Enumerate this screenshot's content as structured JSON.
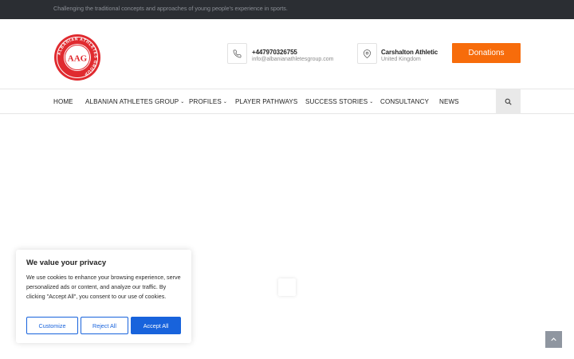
{
  "topbar": {
    "tagline": "Challenging the traditional concepts and approaches of young people's experience in sports."
  },
  "logo": {
    "alt_text": "Albanian Athletes Group",
    "monogram": "AAG",
    "ring_text": "ALBANIAN ATHLETES GROUP",
    "color": "#e02a2f"
  },
  "contact": {
    "phone": "+447970326755",
    "email": "info@albanianathletesgroup.com",
    "location_title": "Carshalton Athletic",
    "location_sub": "United Kingdom"
  },
  "donate_label": "Donations",
  "nav": {
    "items": [
      {
        "label": "HOME",
        "has_dropdown": false
      },
      {
        "label": "ALBANIAN ATHLETES GROUP",
        "has_dropdown": true
      },
      {
        "label": "PROFILES",
        "has_dropdown": true
      },
      {
        "label": "PLAYER PATHWAYS",
        "has_dropdown": false
      },
      {
        "label": "SUCCESS STORIES",
        "has_dropdown": true
      },
      {
        "label": "CONSULTANCY",
        "has_dropdown": false
      },
      {
        "label": "NEWS",
        "has_dropdown": false
      }
    ],
    "search_icon": "search-icon"
  },
  "cookie": {
    "title": "We value your privacy",
    "text": "We use cookies to enhance your browsing experience, serve personalized ads or content, and analyze our traffic. By clicking \"Accept All\", you consent to our use of cookies.",
    "customize_label": "Customize",
    "reject_label": "Reject All",
    "accept_label": "Accept All"
  },
  "colors": {
    "accent": "#f76c0b",
    "cookie_blue": "#1863dc",
    "topbar": "#2b2e33"
  }
}
